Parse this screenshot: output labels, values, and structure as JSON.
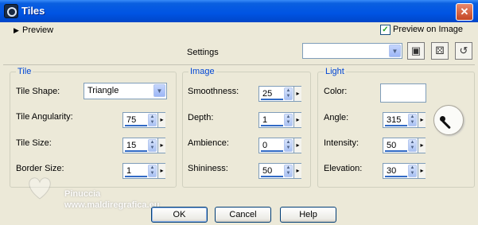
{
  "window": {
    "title": "Tiles",
    "close_glyph": "✕"
  },
  "preview": {
    "label": "Preview",
    "preview_on_image_label": "Preview on Image",
    "preview_on_image_checked": true
  },
  "settings": {
    "label": "Settings",
    "preset_value": ""
  },
  "tile": {
    "title": "Tile",
    "shape_label": "Tile Shape:",
    "shape_value": "Triangle",
    "angularity_label": "Tile Angularity:",
    "angularity_value": "75",
    "size_label": "Tile Size:",
    "size_value": "15",
    "border_label": "Border Size:",
    "border_value": "1"
  },
  "image": {
    "title": "Image",
    "smoothness_label": "Smoothness:",
    "smoothness_value": "25",
    "depth_label": "Depth:",
    "depth_value": "1",
    "ambience_label": "Ambience:",
    "ambience_value": "0",
    "shininess_label": "Shininess:",
    "shininess_value": "50"
  },
  "light": {
    "title": "Light",
    "color_label": "Color:",
    "color_value": "#ffffff",
    "angle_label": "Angle:",
    "angle_value": "315",
    "intensity_label": "Intensity:",
    "intensity_value": "50",
    "elevation_label": "Elevation:",
    "elevation_value": "30"
  },
  "buttons": {
    "ok": "OK",
    "cancel": "Cancel",
    "help": "Help"
  },
  "watermark": {
    "line1": "Pinuccia",
    "line2": "www.maldiregrafica.eu"
  },
  "icons": {
    "save": "save-icon",
    "randomize": "dice-icon",
    "reset": "reset-icon",
    "dropdown": "chevron-down-icon"
  },
  "colors": {
    "titlebar": "#0054e3",
    "group_title": "#0046d5",
    "dialog_bg": "#ece9d8"
  }
}
